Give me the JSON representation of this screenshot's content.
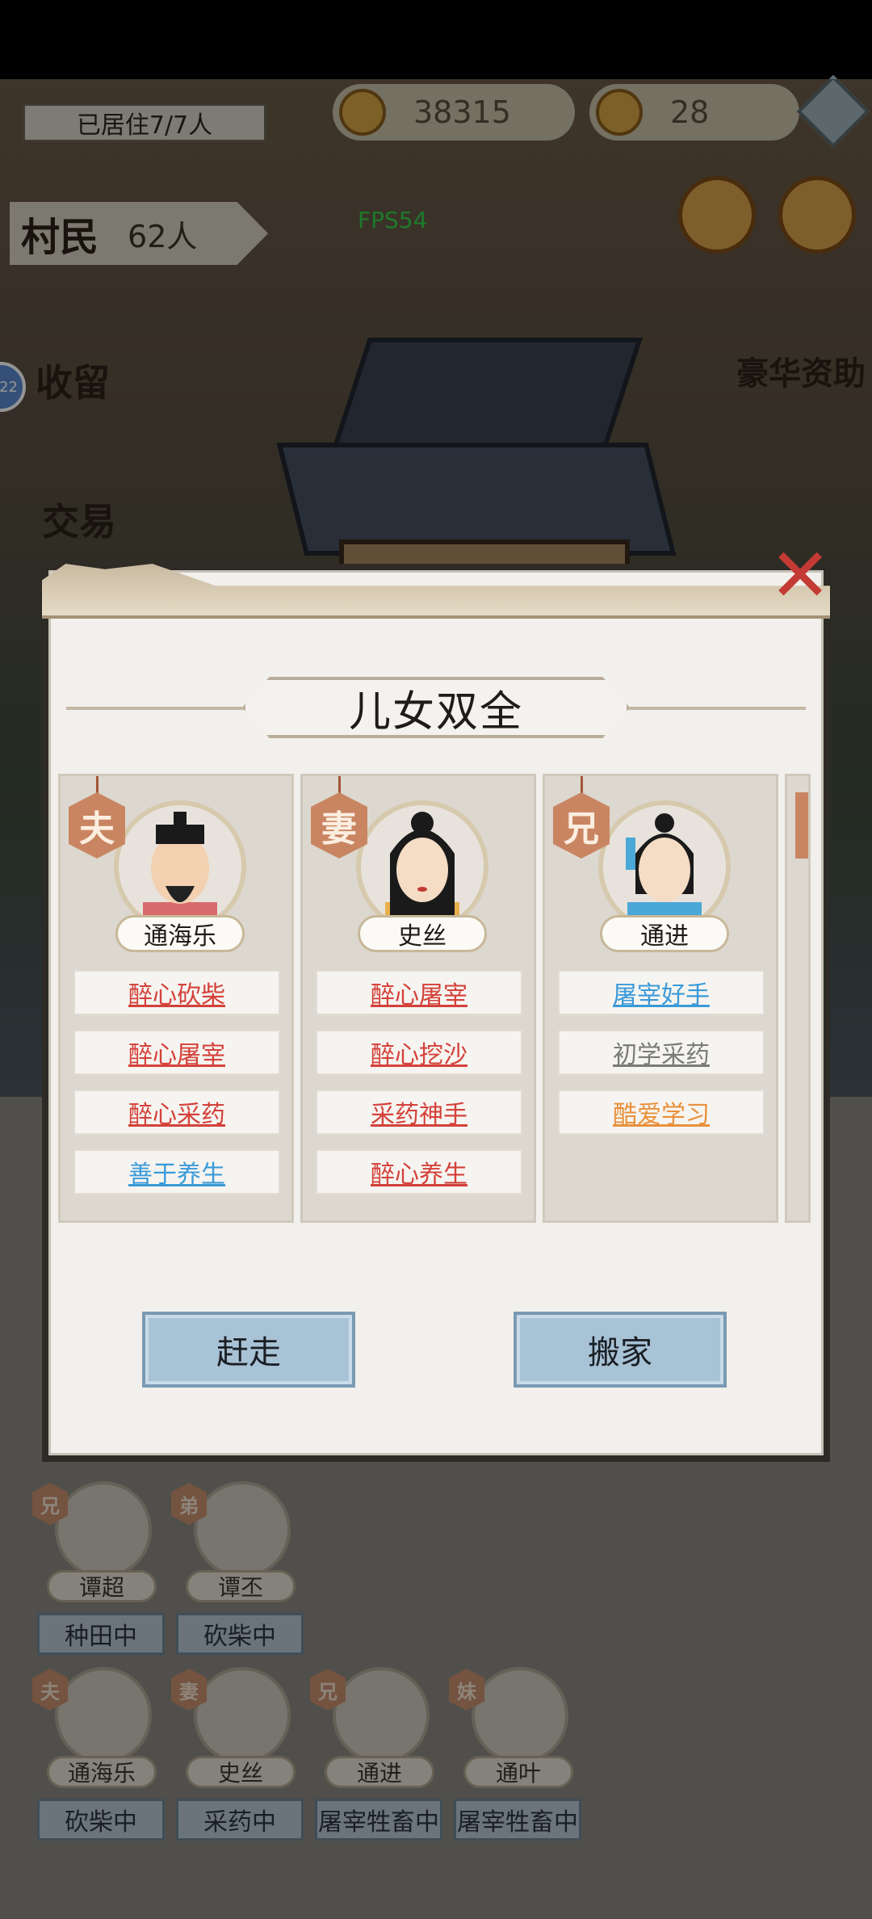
{
  "status_bar": {
    "residents": "已居住7/7人"
  },
  "resources": {
    "coins": "38315",
    "ingots": "28"
  },
  "villagers": {
    "label": "村民",
    "count": "62人"
  },
  "fps": "FPS54",
  "side_buttons": {
    "shelter": "收留",
    "trade": "交易",
    "sponsor": "豪华资助"
  },
  "badge_number": "22",
  "dialog": {
    "title": "儿女双全",
    "members": [
      {
        "role": "夫",
        "name": "通海乐",
        "traits": [
          {
            "text": "醉心砍柴",
            "color": "#d4413a"
          },
          {
            "text": "醉心屠宰",
            "color": "#d4413a"
          },
          {
            "text": "醉心采药",
            "color": "#d4413a"
          },
          {
            "text": "善于养生",
            "color": "#3a9ad9"
          }
        ]
      },
      {
        "role": "妻",
        "name": "史丝",
        "traits": [
          {
            "text": "醉心屠宰",
            "color": "#d4413a"
          },
          {
            "text": "醉心挖沙",
            "color": "#d4413a"
          },
          {
            "text": "采药神手",
            "color": "#d4413a"
          },
          {
            "text": "醉心养生",
            "color": "#d4413a"
          }
        ]
      },
      {
        "role": "兄",
        "name": "通进",
        "traits": [
          {
            "text": "屠宰好手",
            "color": "#3a9ad9"
          },
          {
            "text": "初学采药",
            "color": "#7a7a7a"
          },
          {
            "text": "酷爱学习",
            "color": "#e8903a"
          }
        ]
      }
    ],
    "buttons": {
      "evict": "赶走",
      "move": "搬家"
    }
  },
  "residents_list": [
    {
      "role": "兄",
      "name": "谭超",
      "status": "种田中"
    },
    {
      "role": "弟",
      "name": "谭丕",
      "status": "砍柴中"
    },
    {
      "role": "夫",
      "name": "通海乐",
      "status": "砍柴中"
    },
    {
      "role": "妻",
      "name": "史丝",
      "status": "采药中"
    },
    {
      "role": "兄",
      "name": "通进",
      "status": "屠宰牲畜中"
    },
    {
      "role": "妹",
      "name": "通叶",
      "status": "屠宰牲畜中"
    }
  ],
  "colors": {
    "accent_red": "#c43a34",
    "button_blue": "#a8c2d6",
    "role_badge": "#c98562"
  }
}
